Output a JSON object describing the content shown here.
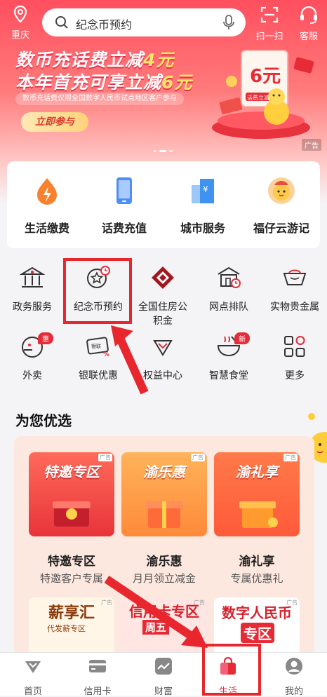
{
  "header": {
    "location": "重庆",
    "search_placeholder": "纪念币预约",
    "scan_label": "扫一扫",
    "service_label": "客服"
  },
  "banner": {
    "line1_a": "数币充话费立减",
    "line1_b": "4元",
    "line2_a": "本年首充可享立减",
    "line2_b": "6元",
    "note": "数币充话费仅限全国数字人民币试点地区客户参与",
    "cta": "立即参与",
    "ad_tag": "广告",
    "card_amount": "6元",
    "card_tag": "话费立减"
  },
  "services": [
    {
      "label": "生活缴费",
      "icon": "lightning-icon"
    },
    {
      "label": "话费充值",
      "icon": "phone-icon"
    },
    {
      "label": "城市服务",
      "icon": "city-building-icon"
    },
    {
      "label": "福仔云游记",
      "icon": "mascot-icon"
    }
  ],
  "grid": {
    "row1": [
      {
        "label": "政务服务",
        "icon": "government-icon"
      },
      {
        "label": "纪念币预约",
        "icon": "coin-clock-icon"
      },
      {
        "label": "全国住房公积金",
        "line1": "全国住房公",
        "line2": "积金",
        "icon": "housing-fund-icon"
      },
      {
        "label": "网点排队",
        "icon": "branch-queue-icon"
      },
      {
        "label": "实物贵金属",
        "icon": "gold-ingot-icon"
      }
    ],
    "row2": [
      {
        "label": "外卖",
        "icon": "takeout-icon",
        "badge": "惠"
      },
      {
        "label": "银联优惠",
        "icon": "unionpay-card-icon"
      },
      {
        "label": "权益中心",
        "icon": "diamond-icon"
      },
      {
        "label": "智慧食堂",
        "icon": "bowl-icon",
        "badge": "新"
      },
      {
        "label": "更多",
        "icon": "more-grid-icon"
      }
    ]
  },
  "recommend": {
    "title": "为您优选",
    "tiles": [
      {
        "tile_text": "特邀专区",
        "name": "特邀专区",
        "sub": "特邀客户专属"
      },
      {
        "tile_text": "渝乐惠",
        "name": "渝乐惠",
        "sub": "月月领立减金"
      },
      {
        "tile_text": "渝礼享",
        "name": "渝礼享",
        "sub": "专属优惠礼"
      }
    ],
    "row2": [
      {
        "text": "薪享汇",
        "sub": "代发薪专区"
      },
      {
        "text": "信用卡专区",
        "sub": "周五"
      },
      {
        "text": "数字人民币",
        "sub": "专区"
      }
    ],
    "ad_tag": "广告"
  },
  "tabbar": [
    {
      "label": "首页",
      "icon": "home-diamond-icon"
    },
    {
      "label": "信用卡",
      "icon": "credit-card-icon"
    },
    {
      "label": "财富",
      "icon": "wealth-chart-icon"
    },
    {
      "label": "生活",
      "icon": "shopping-bag-icon",
      "active": true
    },
    {
      "label": "我的",
      "icon": "user-icon"
    }
  ],
  "colors": {
    "brand_red": "#e62b37",
    "highlight": "#e8262d"
  }
}
